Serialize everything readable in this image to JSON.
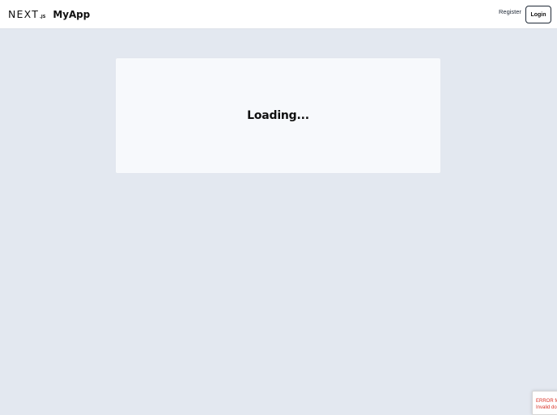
{
  "navbar": {
    "logo_word": "NEXT",
    "logo_suffix": ".JS",
    "app_name": "MyApp",
    "register_label": "Register",
    "login_label": "Login"
  },
  "main": {
    "loading_text": "Loading..."
  },
  "recaptcha": {
    "error_line_1": "ERROR fo",
    "error_line_2": "Invalid do"
  },
  "colors": {
    "page_background": "#e3e8f0",
    "card_background": "#f7f9fc",
    "navbar_background": "#ffffff",
    "error_text": "#d93025"
  }
}
